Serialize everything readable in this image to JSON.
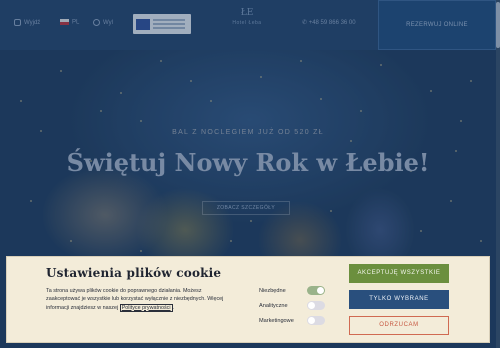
{
  "topbar": {
    "item1": "Wyjdź",
    "lang": "PL",
    "item3": "Wyl",
    "phone": "+48 59 866 36 00",
    "reserve_label": "REZERWUJ ONLINE"
  },
  "logo": {
    "mark": "ŁE",
    "text": "Hotel Łeba"
  },
  "hero": {
    "subtitle": "BAL Z NOCLEGIEM JUŻ OD 520 ZŁ",
    "title": "Świętuj Nowy Rok w Łebie!",
    "cta": "ZOBACZ SZCZEGÓŁY"
  },
  "cookie_modal": {
    "title": "Ustawienia plików cookie",
    "description": "Ta strona używa plików cookie do poprawnego działania. Możesz zaakceptować je wszystkie lub korzystać wyłącznie z niezbędnych. Więcej informacji znajdziesz w naszej",
    "policy_link": "Polityce prywatności",
    "description_end": ".",
    "toggles": [
      {
        "label": "Niezbędne",
        "on": true
      },
      {
        "label": "Analityczne",
        "on": false
      },
      {
        "label": "Marketingowe",
        "on": false
      }
    ],
    "accept_all_label": "AKCEPTUJĘ WSZYSTKIE",
    "selected_only_label": "TYLKO WYBRANE",
    "reject_label": "ODRZUCAM"
  },
  "colors": {
    "accept": "#6b8f3e",
    "selected": "#294f7d",
    "reject": "#c65740",
    "modal_bg": "#f3ecd9"
  }
}
